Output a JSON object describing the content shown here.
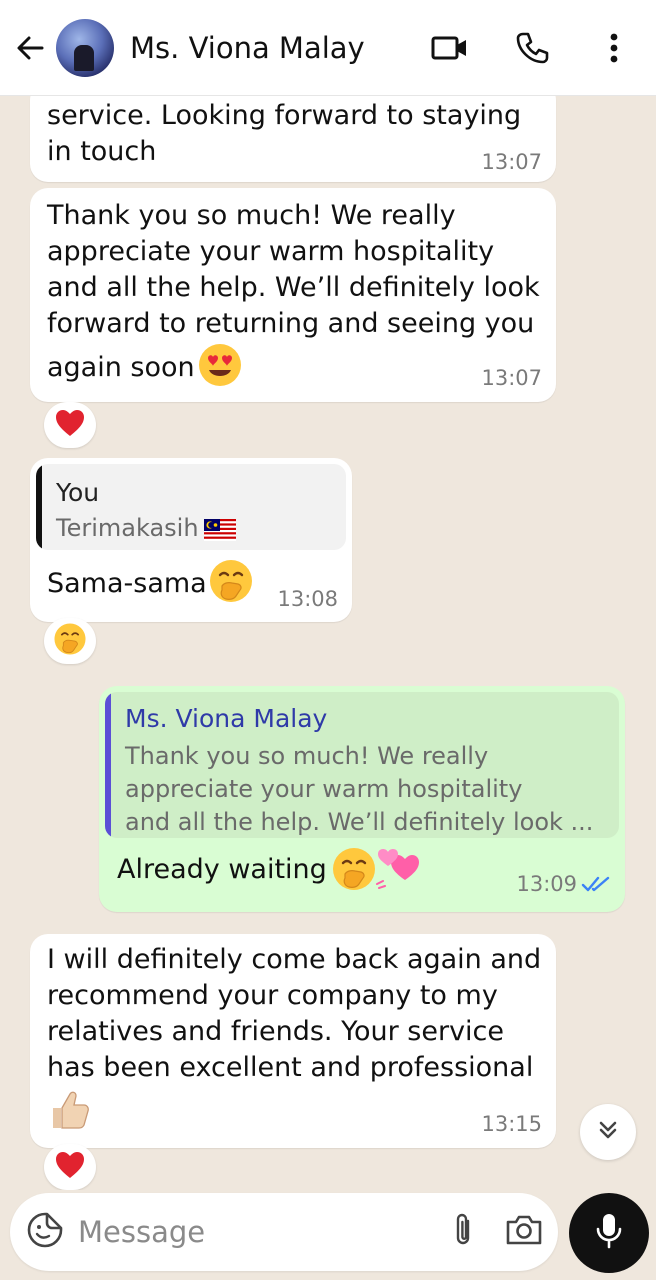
{
  "header": {
    "contact_name": "Ms. Viona Malay"
  },
  "messages": {
    "m1": {
      "line1": "service. Looking forward to staying",
      "line2": "in touch",
      "time": "13:07"
    },
    "m2": {
      "lines": [
        "Thank you so much! We really",
        "appreciate your warm hospitality",
        "and all the help. We’ll definitely look",
        "forward to returning and seeing you"
      ],
      "last": "again soon",
      "emoji": "heart-eyes-emoji",
      "time": "13:07",
      "reaction": "red-heart"
    },
    "m3": {
      "quote_author": "You",
      "quote_text": "Terimakasih",
      "quote_flag": "malaysia-flag",
      "text": "Sama-sama",
      "emoji": "hand-over-mouth-emoji",
      "time": "13:08",
      "reaction": "hand-over-mouth"
    },
    "m4": {
      "quote_author": "Ms. Viona Malay",
      "quote_lines": [
        "Thank you so much! We really",
        "appreciate your warm hospitality",
        "and all the help. We’ll definitely look ..."
      ],
      "text": "Already waiting",
      "emojis": [
        "hand-over-mouth-emoji",
        "two-hearts-emoji"
      ],
      "time": "13:09",
      "status": "read"
    },
    "m5": {
      "lines": [
        "I will definitely come back again and",
        "recommend your company to my",
        "relatives and friends. Your service",
        "has been excellent and professional"
      ],
      "emoji": "thumbs-up-emoji",
      "time": "13:15",
      "reaction": "red-heart"
    }
  },
  "composer": {
    "placeholder": "Message"
  },
  "colors": {
    "chat_bg": "#efe7dd",
    "incoming": "#ffffff",
    "outgoing": "#d9fdd3",
    "own_quote_bar": "#111111",
    "contact_quote_bar": "#5b4fd6",
    "contact_quote_name": "#2f3aa8",
    "read_ticks": "#3b82f6"
  }
}
